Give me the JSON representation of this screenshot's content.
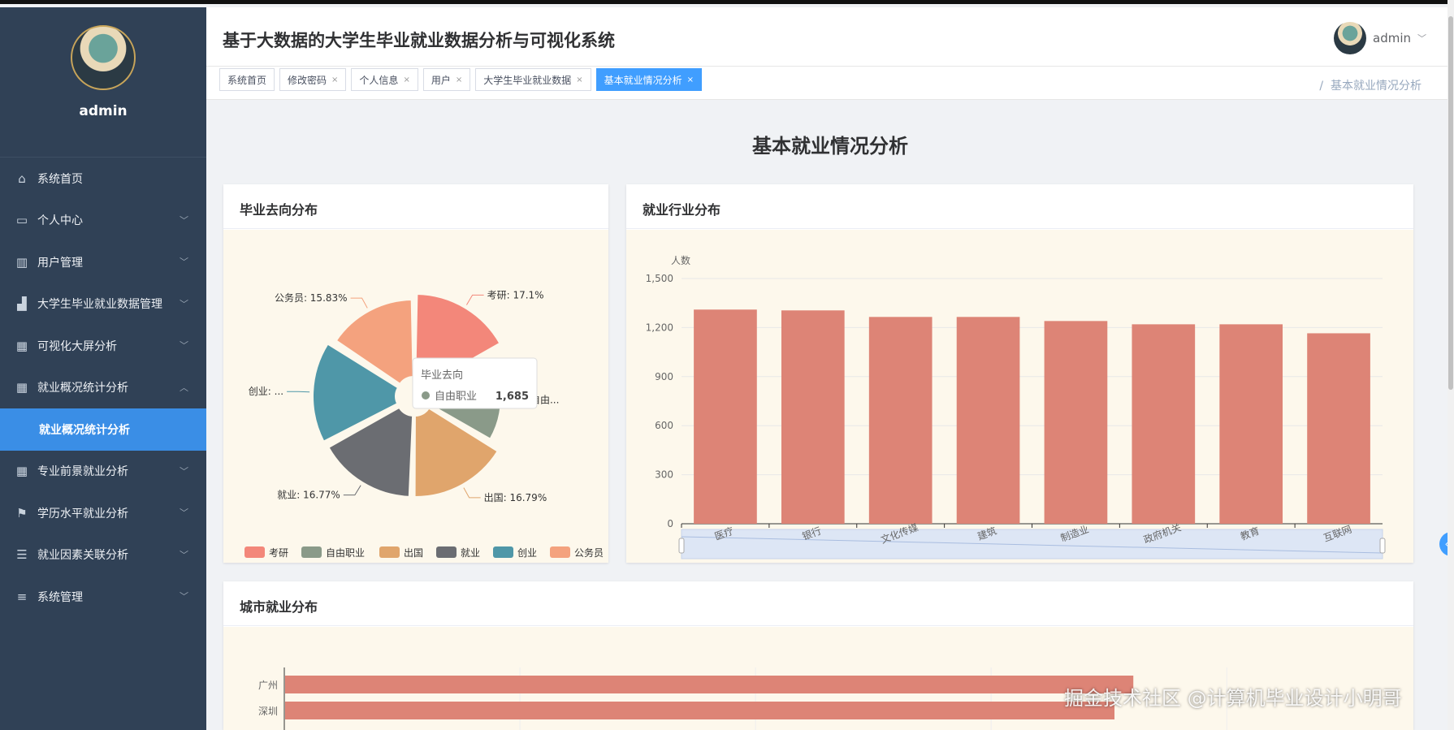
{
  "app": {
    "title": "基于大数据的大学生毕业就业数据分析与可视化系统"
  },
  "user": {
    "name": "admin",
    "dropdown_icon": "chevron-down-icon"
  },
  "sidebar": {
    "username": "admin",
    "items": [
      {
        "label": "系统首页",
        "icon": "home-icon"
      },
      {
        "label": "个人中心",
        "icon": "user-card-icon"
      },
      {
        "label": "用户管理",
        "icon": "users-icon"
      },
      {
        "label": "大学生毕业就业数据管理",
        "icon": "bar-icon"
      },
      {
        "label": "可视化大屏分析",
        "icon": "grid-icon"
      },
      {
        "label": "就业概况统计分析",
        "icon": "grid-icon"
      },
      {
        "label": "就业概况统计分析",
        "icon": "none"
      },
      {
        "label": "专业前景就业分析",
        "icon": "grid-icon"
      },
      {
        "label": "学历水平就业分析",
        "icon": "flag-icon"
      },
      {
        "label": "就业因素关联分析",
        "icon": "sliders-icon"
      },
      {
        "label": "系统管理",
        "icon": "list-icon"
      }
    ]
  },
  "tags": [
    {
      "label": "系统首页",
      "closable": false
    },
    {
      "label": "修改密码",
      "closable": true
    },
    {
      "label": "个人信息",
      "closable": true
    },
    {
      "label": "用户",
      "closable": true
    },
    {
      "label": "大学生毕业就业数据",
      "closable": true
    },
    {
      "label": "基本就业情况分析",
      "closable": true,
      "active": true
    }
  ],
  "breadcrumb": {
    "sep": "/",
    "current": "基本就业情况分析"
  },
  "page": {
    "title": "基本就业情况分析"
  },
  "cards": {
    "pie": {
      "title": "毕业去向分布"
    },
    "industry": {
      "title": "就业行业分布"
    },
    "city": {
      "title": "城市就业分布"
    }
  },
  "tooltip": {
    "title": "毕业去向",
    "name": "自由职业",
    "value": "1,685"
  },
  "watermark": "掘金技术社区 @计算机毕业设计小明哥",
  "colors": {
    "sidebar": "#304156",
    "active": "#409eff",
    "bar": "#dd8476"
  },
  "chart_data": [
    {
      "type": "pie",
      "title": "毕业去向分布",
      "slices": [
        {
          "name": "考研",
          "percent": 17.1,
          "label": "考研: 17.1%",
          "color": "#f3877a"
        },
        {
          "name": "自由职业",
          "percent": 16.5,
          "label": "自由...",
          "color": "#8a9a89"
        },
        {
          "name": "出国",
          "percent": 16.79,
          "label": "出国: 16.79%",
          "color": "#e0a56c"
        },
        {
          "name": "就业",
          "percent": 16.77,
          "label": "就业: 16.77%",
          "color": "#6b6d72"
        },
        {
          "name": "创业",
          "percent": 17.04,
          "label": "创业: ...",
          "color": "#4f97a8"
        },
        {
          "name": "公务员",
          "percent": 15.83,
          "label": "公务员: 15.83%",
          "color": "#f4a27e"
        }
      ],
      "legend": [
        "考研",
        "自由职业",
        "出国",
        "就业",
        "创业",
        "公务员"
      ],
      "legend_position": "bottom"
    },
    {
      "type": "bar",
      "title": "就业行业分布",
      "ylabel": "人数",
      "ylim": [
        0,
        1500
      ],
      "yticks": [
        "0",
        "300",
        "600",
        "900",
        "1,200",
        "1,500"
      ],
      "categories": [
        "医疗",
        "银行",
        "文化传媒",
        "建筑",
        "制造业",
        "政府机关",
        "教育",
        "互联网"
      ],
      "values": [
        1310,
        1305,
        1265,
        1265,
        1240,
        1220,
        1220,
        1165
      ],
      "grid": true,
      "datazoom": true
    },
    {
      "type": "bar",
      "orientation": "horizontal",
      "title": "城市就业分布",
      "categories": [
        "广州",
        "深圳"
      ],
      "values": [
        1350,
        1320
      ],
      "xlim": [
        0,
        1500
      ]
    }
  ]
}
